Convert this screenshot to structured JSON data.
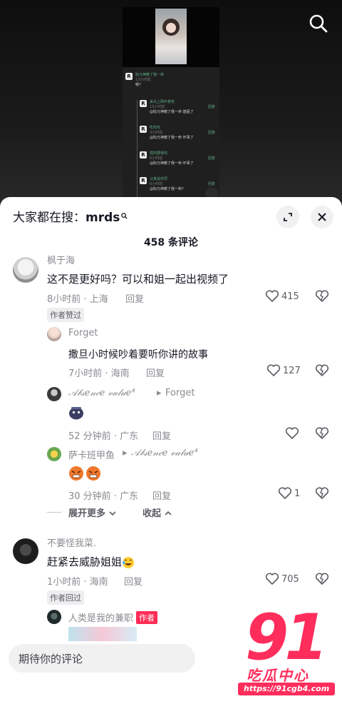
{
  "video": {
    "embedded": {
      "comments": [
        {
          "name": "阮元神教了我一命",
          "time": "13小时前",
          "text": "嗯?",
          "right": ""
        },
        {
          "name": "采鸟上网中意吃",
          "time": "13小时前",
          "text": "@阮元神教了我一命 建瓯了",
          "right": "回复"
        },
        {
          "name": "吃鸡鸡",
          "time": "3小时前",
          "text": "@阮元神教了我一命 坏事了",
          "right": "回复"
        },
        {
          "name": "弱鸡要得鸡",
          "time": "5小时前",
          "text": "@阮元神教了我一命 坏事了",
          "right": "回复"
        },
        {
          "name": "认真说你罕",
          "time": "6小时前",
          "text": "@阮元神教了我一命?",
          "right": "回复"
        }
      ]
    }
  },
  "sheet": {
    "hot_search_prefix": "大家都在搜：",
    "hot_search_keyword": "mrds",
    "comment_count_title": "458 条评论",
    "comments": [
      {
        "username": "枫于海",
        "text": "这不是更好吗？可以和姐一起出视频了",
        "meta": "8小时前 · 上海",
        "reply": "回复",
        "badge": "作者赞过",
        "likes": "415"
      },
      {
        "username": "Forget",
        "text": "撒旦小时候吵着要听你讲的故事",
        "meta": "7小时前 · 海南",
        "reply": "回复",
        "likes": "127"
      },
      {
        "username": "𝒜𝒷𝓈ℯ𝓃𝒸ℯ 𝓋𝒶𝓁𝓊ℯ⁴",
        "reply_to_arrow": "▸",
        "reply_to": "Forget",
        "meta": "52 分钟前 · 广东",
        "reply": "回复",
        "likes": ""
      },
      {
        "username": "萨卡班甲鱼",
        "reply_to_arrow": "▸",
        "reply_to": "𝒜𝒷𝓈ℯ𝓃𝒸ℯ 𝓋𝒶𝓁𝓊ℯ⁴",
        "meta": "30 分钟前 · 广东",
        "reply": "回复",
        "likes": "1"
      },
      {
        "username": "不要怪我菜.",
        "text": "赶紧去威胁姐姐",
        "meta": "1小时前 · 海南",
        "reply": "回复",
        "badge": "作者回过",
        "likes": "705"
      },
      {
        "username": "人类是我的兼职",
        "author_tag": "作者"
      }
    ],
    "expand_more": "展开更多",
    "collapse": "收起",
    "input_placeholder": "期待你的评论"
  },
  "watermark": {
    "number": "91",
    "chinese": "吃瓜中心",
    "url": "https://91cgb4.com"
  },
  "colors": {
    "accent_red": "#fe2c55",
    "watermark_pink": "#ff2d5c",
    "text_primary": "#161823",
    "text_secondary": "#8a8b91"
  },
  "icons": [
    "search-icon",
    "expand-icon",
    "close-icon",
    "heart-icon",
    "dislike-heart-icon",
    "chevron-down-icon",
    "chevron-up-icon"
  ]
}
